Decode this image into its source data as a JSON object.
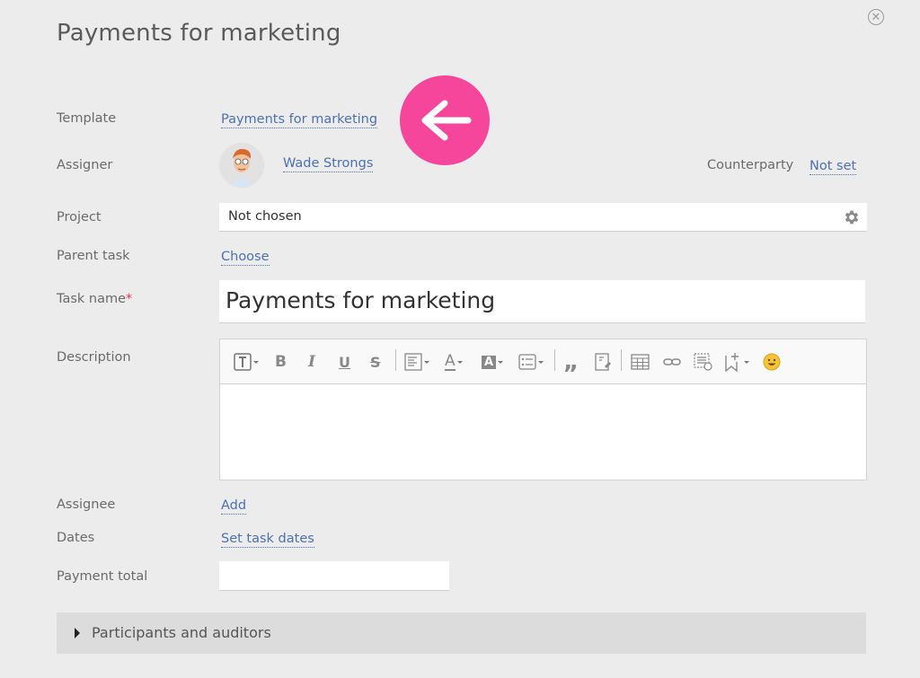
{
  "page": {
    "title": "Payments for marketing"
  },
  "template": {
    "label": "Template",
    "value": "Payments for marketing"
  },
  "assigner": {
    "label": "Assigner",
    "name": "Wade Strongs"
  },
  "counterparty": {
    "label": "Counterparty",
    "value": "Not set"
  },
  "project": {
    "label": "Project",
    "value": "Not chosen"
  },
  "parent_task": {
    "label": "Parent task",
    "value": "Choose"
  },
  "task_name": {
    "label": "Task name",
    "required_mark": "*",
    "value": "Payments for marketing"
  },
  "description": {
    "label": "Description",
    "toolbar": [
      "text-format-icon",
      "bold-icon",
      "italic-icon",
      "underline-icon",
      "strikethrough-icon",
      "align-icon",
      "font-color-icon",
      "highlight-color-icon",
      "list-icon",
      "quote-icon",
      "insert-file-icon",
      "table-icon",
      "link-icon",
      "insert-image-icon",
      "bookmark-add-icon",
      "emoji-icon"
    ],
    "toolbar_text": {
      "bold": "B",
      "italic": "I",
      "underline": "U",
      "strike": "S",
      "font_color": "A",
      "highlight": "A",
      "quote": "„"
    },
    "value": ""
  },
  "assignee": {
    "label": "Assignee",
    "value": "Add"
  },
  "dates": {
    "label": "Dates",
    "value": "Set task dates"
  },
  "payment_total": {
    "label": "Payment total",
    "value": ""
  },
  "participants": {
    "label": "Participants and auditors"
  },
  "colors": {
    "accent_link": "#4b70b3",
    "nav_bubble": "#f6469b",
    "background": "#ececec"
  }
}
